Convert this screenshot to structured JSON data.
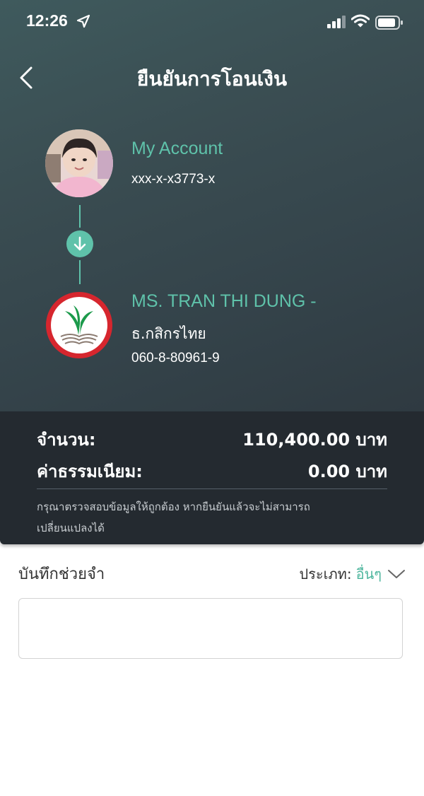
{
  "status_bar": {
    "time": "12:26"
  },
  "header": {
    "title": "ยืนยันการโอนเงิน"
  },
  "from": {
    "name": "My Account",
    "account": "xxx-x-x3773-x"
  },
  "to": {
    "name": "MS. TRAN THI DUNG -",
    "bank": "ธ.กสิกรไทย",
    "account": "060-8-80961-9"
  },
  "summary": {
    "amount_label": "จำนวน:",
    "amount_value": "110,400.00 บาท",
    "fee_label": "ค่าธรรมเนียม:",
    "fee_value": "0.00 บาท",
    "warning_line1": "กรุณาตรวจสอบข้อมูลให้ถูกต้อง หากยืนยันแล้วจะไม่สามารถ",
    "warning_line2": "เปลี่ยนแปลงได้"
  },
  "memo": {
    "label": "บันทึกช่วยจำ",
    "type_label": "ประเภท:",
    "type_value": "อื่นๆ",
    "value": "",
    "placeholder": ""
  },
  "colors": {
    "accent": "#5fc2aa",
    "header_dark": "#34434a",
    "summary_bg": "#242a30",
    "bank_green": "#1c9a4b",
    "bank_red": "#d6262e"
  },
  "icons": {
    "back": "chevron-left-icon",
    "location": "location-arrow-icon",
    "signal": "signal-icon",
    "wifi": "wifi-icon",
    "battery": "battery-icon",
    "transfer": "arrow-down-icon",
    "type_dropdown": "chevron-down-icon"
  }
}
